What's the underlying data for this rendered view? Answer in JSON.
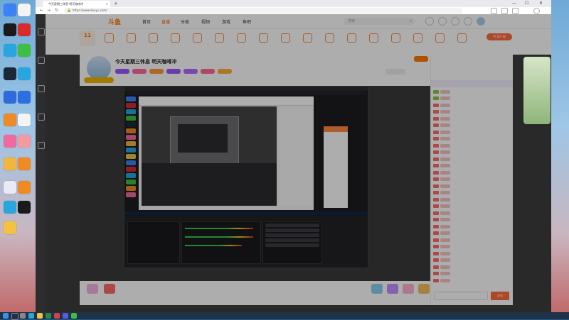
{
  "desktop": {
    "icons": [
      {
        "name": "feishu-icon",
        "label": "",
        "color": "#3b82f6"
      },
      {
        "name": "photo-icon",
        "label": "",
        "color": "#f4f4f4"
      },
      {
        "name": "dota-icon",
        "label": "",
        "color": "#1a1a1a"
      },
      {
        "name": "netease-music-icon",
        "label": "",
        "color": "#d92b2b"
      },
      {
        "name": "edge-icon",
        "label": "",
        "color": "#27a6e0"
      },
      {
        "name": "wechat-icon",
        "label": "",
        "color": "#3fbf3f"
      },
      {
        "name": "steam-icon",
        "label": "",
        "color": "#1b2838"
      },
      {
        "name": "edge2-icon",
        "label": "",
        "color": "#27a6e0"
      },
      {
        "name": "feishu2-icon",
        "label": "",
        "color": "#2f6bdc"
      },
      {
        "name": "app-blue-icon",
        "label": "",
        "color": "#2a70e0"
      },
      {
        "name": "app-orange-icon",
        "label": "",
        "color": "#f08a24"
      },
      {
        "name": "app-white-icon",
        "label": "",
        "color": "#f4f4f4"
      },
      {
        "name": "app-pink-icon",
        "label": "",
        "color": "#f06aa0"
      },
      {
        "name": "app-lighter-icon",
        "label": "",
        "color": "#f59aa0"
      },
      {
        "name": "app-bird-icon",
        "label": "",
        "color": "#f2b640"
      },
      {
        "name": "app-cat-icon",
        "label": "",
        "color": "#f08a24"
      },
      {
        "name": "app-grid-icon",
        "label": "",
        "color": "#eaeaf5"
      },
      {
        "name": "app-monitor-icon",
        "label": "",
        "color": "#f08a24"
      },
      {
        "name": "edge3-icon",
        "label": "",
        "color": "#27a6e0"
      },
      {
        "name": "qq-icon",
        "label": "",
        "color": "#1a1a1a"
      },
      {
        "name": "app-yellow-icon",
        "label": "",
        "color": "#f2c340"
      }
    ]
  },
  "browser": {
    "tab_title": "今天星期三休息 明天咖啡冲",
    "url": "https://www.douyu.com/",
    "new_tab": "+",
    "min": "—",
    "max": "☐",
    "close": "✕"
  },
  "site": {
    "logo": "斗鱼",
    "nav": [
      "首页",
      "直播",
      "分类",
      "视频",
      "游戏",
      "鱼吧"
    ],
    "active_nav": "直播",
    "search_placeholder": "搜索",
    "pc_download": "PC客户端",
    "cat_badge_num": "11",
    "cat_badge_label": "",
    "categories": [
      "",
      "",
      "",
      "",
      "",
      "",
      "",
      "",
      "",
      "",
      "",
      "",
      "",
      "",
      "",
      "",
      ""
    ]
  },
  "room": {
    "title": "今天星期三休息 明天咖啡冲",
    "meta": "",
    "follow": "",
    "tags": [
      {
        "text": "",
        "color": "#9b59ff"
      },
      {
        "text": "",
        "color": "#ff6a9a"
      },
      {
        "text": "",
        "color": "#ff9a3d"
      },
      {
        "text": "",
        "color": "#9b59ff"
      },
      {
        "text": "",
        "color": "#b06aff"
      },
      {
        "text": "",
        "color": "#ff6a9a"
      },
      {
        "text": "",
        "color": "#ffb03d"
      }
    ]
  },
  "gifts": [
    {
      "color": "#f4b3e3"
    },
    {
      "color": "#ff6a6a"
    },
    {
      "color": "#8ad0f0"
    },
    {
      "color": "#c090ff"
    },
    {
      "color": "#ffb0d0"
    },
    {
      "color": "#f4c060"
    },
    {
      "color": "#f0a0c0"
    }
  ],
  "charge_label": "充值",
  "chat": {
    "tab": "",
    "top_labels": [
      "",
      "",
      "",
      ""
    ],
    "messages": [
      {
        "badge": "#8bc34a",
        "name": "",
        "text": ""
      },
      {
        "badge": "#8bc34a",
        "name": "",
        "text": ""
      },
      {
        "badge": "#ff6a6a",
        "name": "",
        "text": ""
      },
      {
        "badge": "#ff6a6a",
        "name": "",
        "text": ""
      },
      {
        "badge": "#ff6a6a",
        "name": "",
        "text": ""
      },
      {
        "badge": "#ff6a6a",
        "name": "",
        "text": ""
      },
      {
        "badge": "#ff6a6a",
        "name": "",
        "text": ""
      },
      {
        "badge": "#ff6a6a",
        "name": "",
        "text": ""
      },
      {
        "badge": "#ff6a6a",
        "name": "",
        "text": ""
      },
      {
        "badge": "#ff6a6a",
        "name": "",
        "text": ""
      },
      {
        "badge": "#ff6a6a",
        "name": "",
        "text": ""
      },
      {
        "badge": "#ff6a6a",
        "name": "",
        "text": ""
      },
      {
        "badge": "#ff6a6a",
        "name": "",
        "text": ""
      },
      {
        "badge": "#ff6a6a",
        "name": "",
        "text": ""
      },
      {
        "badge": "#ff6a6a",
        "name": "",
        "text": ""
      },
      {
        "badge": "#ff6a6a",
        "name": "",
        "text": ""
      },
      {
        "badge": "#ff6a6a",
        "name": "",
        "text": ""
      },
      {
        "badge": "#ff6a6a",
        "name": "",
        "text": ""
      },
      {
        "badge": "#ff6a6a",
        "name": "",
        "text": ""
      },
      {
        "badge": "#ff6a6a",
        "name": "",
        "text": ""
      },
      {
        "badge": "#ff6a6a",
        "name": "",
        "text": ""
      },
      {
        "badge": "#ff6a6a",
        "name": "",
        "text": ""
      },
      {
        "badge": "#ff6a6a",
        "name": "",
        "text": ""
      },
      {
        "badge": "#ff6a6a",
        "name": "",
        "text": ""
      },
      {
        "badge": "#ff6a6a",
        "name": "",
        "text": ""
      },
      {
        "badge": "#ff6a6a",
        "name": "",
        "text": ""
      },
      {
        "badge": "#ff6a6a",
        "name": "",
        "text": ""
      },
      {
        "badge": "#ff6a6a",
        "name": "",
        "text": ""
      },
      {
        "badge": "#ff6a6a",
        "name": "",
        "text": ""
      }
    ],
    "input_placeholder": "",
    "send": "发送"
  },
  "taskbar": {
    "time": "",
    "date": ""
  }
}
